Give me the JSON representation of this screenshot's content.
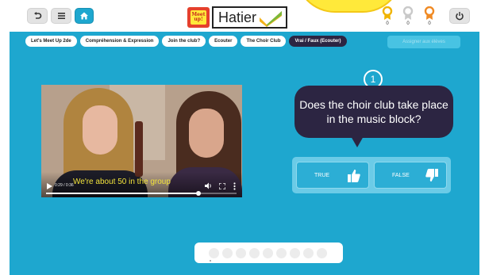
{
  "colors": {
    "background": "#1ea7cf",
    "dark_accent": "#2c2542",
    "brand_yellow": "#ffe93a",
    "brand_red": "#e5402c",
    "subtitle_yellow": "#f1e23b"
  },
  "header": {
    "logo_text": "Meet up!",
    "brand_name": "Hatier",
    "buttons": {
      "undo_icon": "undo-arrow-icon",
      "menu_icon": "hamburger-menu-icon",
      "home_icon": "home-icon",
      "power_icon": "power-icon"
    },
    "medals": [
      {
        "color": "#f0b400",
        "count": "0"
      },
      {
        "color": "#c9c9c9",
        "count": "0"
      },
      {
        "color": "#f08a24",
        "count": "0"
      }
    ]
  },
  "breadcrumb": {
    "items": [
      {
        "label": "Let's Meet Up 2de"
      },
      {
        "label": "Compréhension & Expression"
      },
      {
        "label": "Join the club?"
      },
      {
        "label": "Ecouter"
      },
      {
        "label": "The Choir Club"
      },
      {
        "label": "Vrai / Faux (Ecouter)"
      }
    ],
    "assign_button": "Assigner aux élèves"
  },
  "video": {
    "subtitle": "We're about 50 in the group",
    "time": "0:29 / 0:36",
    "progress": 0.8
  },
  "question": {
    "number": "1",
    "text": "Does the choir club take place in the music block?",
    "true_label": "TRUE",
    "false_label": "FALSE",
    "true_icon": "thumbs-up-icon",
    "false_icon": "thumbs-down-icon"
  },
  "pager": {
    "count": 9
  }
}
